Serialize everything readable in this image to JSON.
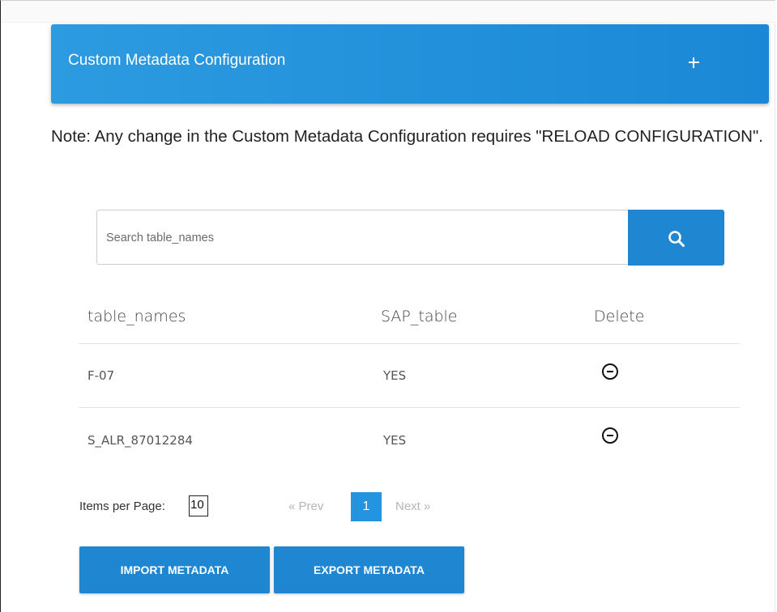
{
  "panel": {
    "title": "Custom Metadata Configuration",
    "add_icon": "plus-icon"
  },
  "note": "Note: Any change in the Custom Metadata Configuration requires \"RELOAD CONFIGURATION\".",
  "search": {
    "placeholder": "Search table_names",
    "value": "",
    "icon": "search-icon"
  },
  "table": {
    "headers": [
      "table_names",
      "SAP_table",
      "Delete"
    ],
    "rows": [
      {
        "table_name": "F-07",
        "sap_table": "YES",
        "delete_icon": "minus-circle-icon"
      },
      {
        "table_name": "S_ALR_87012284",
        "sap_table": "YES",
        "delete_icon": "minus-circle-icon"
      }
    ]
  },
  "pagination": {
    "items_per_page_label": "Items per Page:",
    "items_per_page_value": "10",
    "prev_label": "« Prev",
    "current_page": "1",
    "next_label": "Next »"
  },
  "actions": {
    "import_label": "IMPORT METADATA",
    "export_label": "EXPORT METADATA"
  },
  "colors": {
    "primary": "#1f86d2",
    "header_gradient_start": "#2c9be0",
    "active_page": "#2394e0"
  }
}
